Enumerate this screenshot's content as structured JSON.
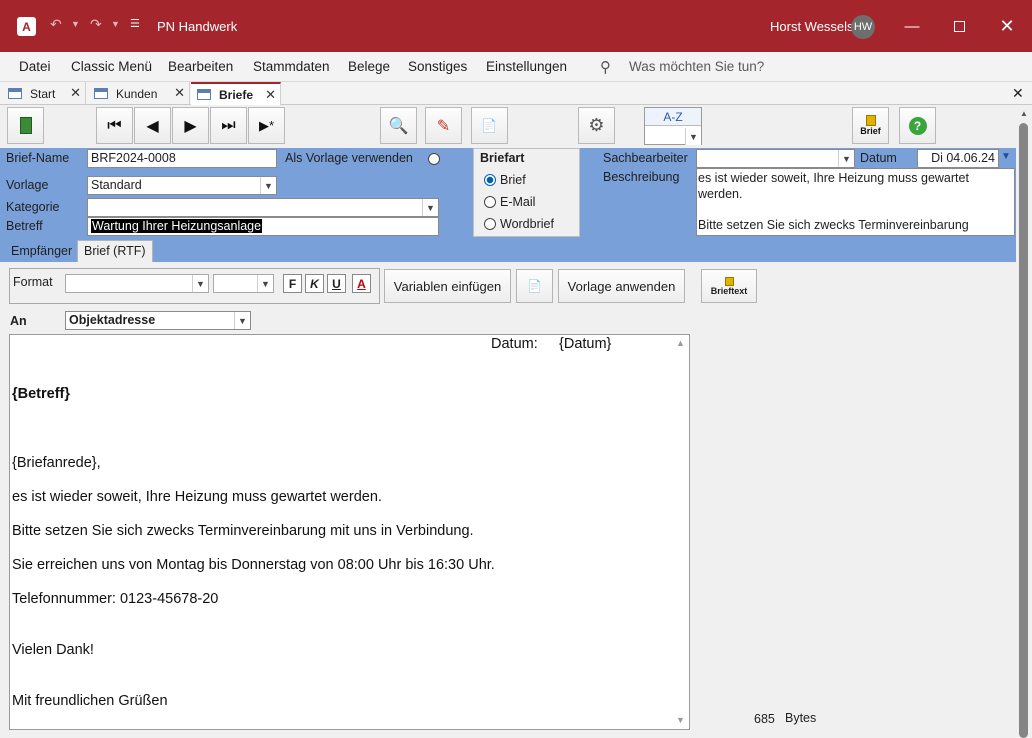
{
  "window": {
    "title": "PN Handwerk",
    "user_name": "Horst Wessels",
    "user_initials": "HW",
    "accent": "#a4262c"
  },
  "menu": {
    "items": [
      "Datei",
      "Classic Menü",
      "Bearbeiten",
      "Stammdaten",
      "Belege",
      "Sonstiges",
      "Einstellungen"
    ],
    "search_placeholder": "Was möchten Sie tun?"
  },
  "tabs": [
    {
      "label": "Start"
    },
    {
      "label": "Kunden"
    },
    {
      "label": "Briefe"
    }
  ],
  "toolbar": {
    "sort_label": "A-Z",
    "brief_label": "Brief"
  },
  "form": {
    "brief_name_label": "Brief-Name",
    "brief_name_value": "BRF2024-0008",
    "vorlage_check_label": "Als Vorlage verwenden",
    "vorlage_label": "Vorlage",
    "vorlage_value": "Standard",
    "kategorie_label": "Kategorie",
    "kategorie_value": "",
    "betreff_label": "Betreff",
    "betreff_value": "Wartung Ihrer Heizungsanlage",
    "briefart_label": "Briefart",
    "briefart_options": [
      "Brief",
      "E-Mail",
      "Wordbrief"
    ],
    "briefart_selected": "Brief",
    "sachbearbeiter_label": "Sachbearbeiter",
    "sachbearbeiter_value": "",
    "datum_label": "Datum",
    "datum_value": "Di 04.06.24",
    "beschreibung_label": "Beschreibung",
    "beschreibung_line1": "es ist wieder soweit, Ihre Heizung muss gewartet",
    "beschreibung_line2": "werden.",
    "beschreibung_line3": "Bitte setzen Sie sich zwecks Terminvereinbarung"
  },
  "subtabs": {
    "empfaenger": "Empfänger",
    "brief_rtf": "Brief (RTF)"
  },
  "editor_toolbar": {
    "format_label": "Format",
    "bold": "F",
    "italic": "K",
    "underline": "U",
    "color": "A",
    "variablen_button": "Variablen einfügen",
    "vorlage_anwenden_button": "Vorlage anwenden",
    "brieftext_button": "Brieftext",
    "an_label": "An",
    "an_value": "Objektadresse"
  },
  "editor": {
    "datum_label": "Datum:",
    "datum_placeholder": "{Datum}",
    "betreff": "{Betreff}",
    "anrede": "{Briefanrede},",
    "line1": "es ist wieder soweit, Ihre Heizung muss gewartet werden.",
    "line2": "Bitte setzen Sie sich zwecks Terminvereinbarung mit uns in Verbindung.",
    "line3": "Sie erreichen uns von Montag bis Donnerstag von 08:00 Uhr bis 16:30 Uhr.",
    "line4": "Telefonnummer: 0123-45678-20",
    "thanks": "Vielen Dank!",
    "closing": "Mit freundlichen Grüßen"
  },
  "footer": {
    "size_value": "685",
    "size_unit": "Bytes"
  }
}
